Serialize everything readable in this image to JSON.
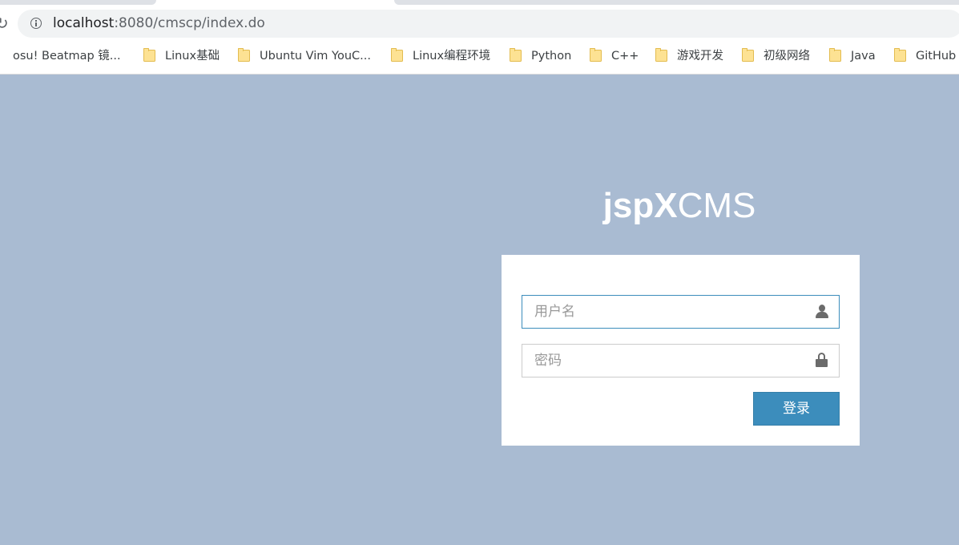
{
  "browser": {
    "url_host": "localhost",
    "url_rest": ":8080/cmscp/index.do",
    "bookmarks": [
      {
        "label": "osu! Beatmap 镜...",
        "icon": "page-icon"
      },
      {
        "label": "Linux基础",
        "icon": "folder-icon"
      },
      {
        "label": "Ubuntu Vim YouC...",
        "icon": "folder-icon"
      },
      {
        "label": "Linux编程环境",
        "icon": "folder-icon"
      },
      {
        "label": "Python",
        "icon": "folder-icon"
      },
      {
        "label": "C++",
        "icon": "folder-icon"
      },
      {
        "label": "游戏开发",
        "icon": "folder-icon"
      },
      {
        "label": "初级网络",
        "icon": "folder-icon"
      },
      {
        "label": "Java",
        "icon": "folder-icon"
      },
      {
        "label": "GitHub",
        "icon": "folder-icon"
      }
    ]
  },
  "login": {
    "title_bold": "jspX",
    "title_regular": "CMS",
    "username_placeholder": "用户名",
    "username_value": "",
    "password_placeholder": "密码",
    "password_value": "",
    "submit_label": "登录"
  },
  "colors": {
    "page_background": "#a9bbd2",
    "accent": "#3c8dbc",
    "card_background": "#ffffff"
  }
}
